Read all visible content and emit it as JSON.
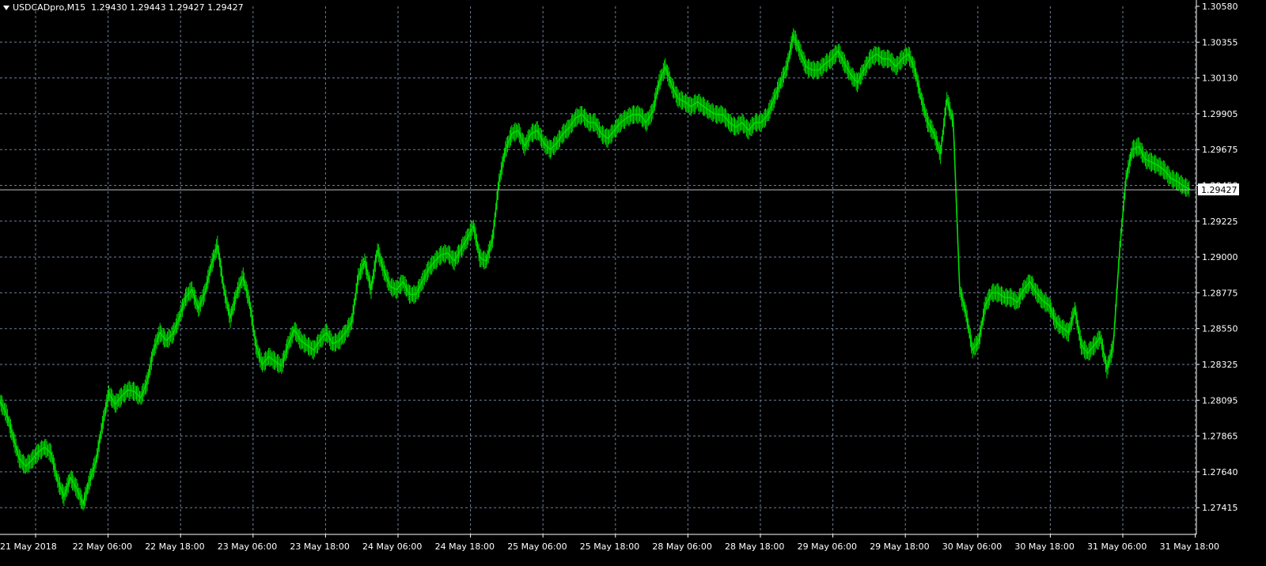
{
  "header": {
    "symbol_timeframe": "USDCADpro,M15",
    "ohlc": "1.29430 1.29443 1.29427 1.29427"
  },
  "colors": {
    "background": "#000000",
    "grid": "#6e7f98",
    "candle": "#00dd00",
    "axis_text": "#ffffff",
    "price_line": "#c0c0c0"
  },
  "chart_data": {
    "type": "line",
    "title": "",
    "xlabel": "",
    "ylabel": "",
    "grid": true,
    "ylim": [
      1.27302,
      1.3058
    ],
    "y_ticks": [
      "1.30580",
      "1.30355",
      "1.30130",
      "1.29905",
      "1.29675",
      "1.29450",
      "1.29225",
      "1.29000",
      "1.28775",
      "1.28550",
      "1.28325",
      "1.28095",
      "1.27865",
      "1.27640",
      "1.27415"
    ],
    "x_ticks": [
      "21 May 2018",
      "22 May 06:00",
      "22 May 18:00",
      "23 May 06:00",
      "23 May 18:00",
      "24 May 06:00",
      "24 May 18:00",
      "25 May 06:00",
      "25 May 18:00",
      "28 May 06:00",
      "28 May 18:00",
      "29 May 06:00",
      "29 May 18:00",
      "30 May 06:00",
      "30 May 18:00",
      "31 May 06:00",
      "31 May 18:00"
    ],
    "current_price": "1.29427",
    "series": [
      {
        "x": [
          "21 May 2018",
          "22 May 06:00",
          "22 May 18:00",
          "23 May 06:00",
          "23 May 18:00",
          "24 May 06:00",
          "24 May 18:00",
          "25 May 06:00",
          "25 May 18:00",
          "28 May 06:00",
          "28 May 18:00",
          "29 May 06:00",
          "29 May 18:00",
          "30 May 06:00",
          "30 May 18:00",
          "31 May 06:00",
          "31 May 18:00"
        ],
        "points": [
          [
            0,
            1.281
          ],
          [
            1,
            1.2802
          ],
          [
            2,
            1.2788
          ],
          [
            3,
            1.2774
          ],
          [
            4,
            1.2769
          ],
          [
            5,
            1.2773
          ],
          [
            6,
            1.2778
          ],
          [
            7,
            1.2781
          ],
          [
            8,
            1.2777
          ],
          [
            9,
            1.276
          ],
          [
            10,
            1.275
          ],
          [
            11,
            1.2762
          ],
          [
            12,
            1.2755
          ],
          [
            13,
            1.2745
          ],
          [
            14,
            1.276
          ],
          [
            15,
            1.2772
          ],
          [
            16,
            1.2795
          ],
          [
            17,
            1.2815
          ],
          [
            18,
            1.2808
          ],
          [
            19,
            1.2813
          ],
          [
            20,
            1.2817
          ],
          [
            21,
            1.2816
          ],
          [
            22,
            1.2812
          ],
          [
            23,
            1.2822
          ],
          [
            24,
            1.2842
          ],
          [
            25,
            1.2853
          ],
          [
            26,
            1.2848
          ],
          [
            27,
            1.2852
          ],
          [
            28,
            1.2862
          ],
          [
            29,
            1.2875
          ],
          [
            30,
            1.288
          ],
          [
            31,
            1.2868
          ],
          [
            32,
            1.2878
          ],
          [
            33,
            1.2895
          ],
          [
            34,
            1.2908
          ],
          [
            35,
            1.288
          ],
          [
            36,
            1.2862
          ],
          [
            37,
            1.2878
          ],
          [
            38,
            1.2888
          ],
          [
            39,
            1.2872
          ],
          [
            40,
            1.2845
          ],
          [
            41,
            1.2833
          ],
          [
            42,
            1.2838
          ],
          [
            43,
            1.2835
          ],
          [
            44,
            1.2832
          ],
          [
            45,
            1.2845
          ],
          [
            46,
            1.2855
          ],
          [
            47,
            1.2848
          ],
          [
            48,
            1.2845
          ],
          [
            49,
            1.2842
          ],
          [
            50,
            1.2848
          ],
          [
            51,
            1.2853
          ],
          [
            52,
            1.2846
          ],
          [
            53,
            1.2848
          ],
          [
            54,
            1.2853
          ],
          [
            55,
            1.286
          ],
          [
            56,
            1.2888
          ],
          [
            57,
            1.2898
          ],
          [
            58,
            1.288
          ],
          [
            59,
            1.2905
          ],
          [
            60,
            1.2892
          ],
          [
            61,
            1.2882
          ],
          [
            62,
            1.288
          ],
          [
            63,
            1.2885
          ],
          [
            64,
            1.2877
          ],
          [
            65,
            1.2877
          ],
          [
            66,
            1.2885
          ],
          [
            67,
            1.2893
          ],
          [
            68,
            1.2898
          ],
          [
            69,
            1.2902
          ],
          [
            70,
            1.2903
          ],
          [
            71,
            1.2898
          ],
          [
            72,
            1.2905
          ],
          [
            73,
            1.2912
          ],
          [
            74,
            1.292
          ],
          [
            75,
            1.29
          ],
          [
            76,
            1.2898
          ],
          [
            77,
            1.2912
          ],
          [
            78,
            1.2948
          ],
          [
            79,
            1.2968
          ],
          [
            80,
            1.2978
          ],
          [
            81,
            1.298
          ],
          [
            82,
            1.297
          ],
          [
            83,
            1.2978
          ],
          [
            84,
            1.298
          ],
          [
            85,
            1.2972
          ],
          [
            86,
            1.2968
          ],
          [
            87,
            1.2972
          ],
          [
            88,
            1.2978
          ],
          [
            89,
            1.2982
          ],
          [
            90,
            1.2988
          ],
          [
            91,
            1.299
          ],
          [
            92,
            1.2985
          ],
          [
            93,
            1.2985
          ],
          [
            94,
            1.2978
          ],
          [
            95,
            1.2975
          ],
          [
            96,
            1.298
          ],
          [
            97,
            1.2985
          ],
          [
            98,
            1.2988
          ],
          [
            99,
            1.299
          ],
          [
            100,
            1.299
          ],
          [
            101,
            1.2985
          ],
          [
            102,
            1.2992
          ],
          [
            103,
            1.301
          ],
          [
            104,
            1.302
          ],
          [
            105,
            1.3008
          ],
          [
            106,
            1.3
          ],
          [
            107,
            1.2998
          ],
          [
            108,
            1.2995
          ],
          [
            109,
            1.2998
          ],
          [
            110,
            1.2995
          ],
          [
            111,
            1.2992
          ],
          [
            112,
            1.299
          ],
          [
            113,
            1.299
          ],
          [
            114,
            1.2985
          ],
          [
            115,
            1.2982
          ],
          [
            116,
            1.2985
          ],
          [
            117,
            1.298
          ],
          [
            118,
            1.2985
          ],
          [
            119,
            1.2985
          ],
          [
            120,
            1.299
          ],
          [
            121,
            1.3
          ],
          [
            122,
            1.301
          ],
          [
            123,
            1.302
          ],
          [
            124,
            1.304
          ],
          [
            125,
            1.303
          ],
          [
            126,
            1.302
          ],
          [
            127,
            1.3018
          ],
          [
            128,
            1.3018
          ],
          [
            129,
            1.3022
          ],
          [
            130,
            1.3025
          ],
          [
            131,
            1.303
          ],
          [
            132,
            1.3022
          ],
          [
            133,
            1.3015
          ],
          [
            134,
            1.301
          ],
          [
            135,
            1.3018
          ],
          [
            136,
            1.3025
          ],
          [
            137,
            1.3028
          ],
          [
            138,
            1.3025
          ],
          [
            139,
            1.3025
          ],
          [
            140,
            1.302
          ],
          [
            141,
            1.3025
          ],
          [
            142,
            1.3028
          ],
          [
            143,
            1.3018
          ],
          [
            144,
            1.3
          ],
          [
            145,
            1.2985
          ],
          [
            146,
            1.2978
          ],
          [
            147,
            1.2965
          ],
          [
            148,
            1.3
          ],
          [
            149,
            1.2985
          ],
          [
            150,
            1.288
          ],
          [
            151,
            1.2865
          ],
          [
            152,
            1.2842
          ],
          [
            153,
            1.2848
          ],
          [
            154,
            1.287
          ],
          [
            155,
            1.2878
          ],
          [
            156,
            1.2878
          ],
          [
            157,
            1.2875
          ],
          [
            158,
            1.2875
          ],
          [
            159,
            1.2872
          ],
          [
            160,
            1.288
          ],
          [
            161,
            1.2885
          ],
          [
            162,
            1.2878
          ],
          [
            163,
            1.2873
          ],
          [
            164,
            1.287
          ],
          [
            165,
            1.286
          ],
          [
            166,
            1.2856
          ],
          [
            167,
            1.2853
          ],
          [
            168,
            1.2868
          ],
          [
            169,
            1.2845
          ],
          [
            170,
            1.284
          ],
          [
            171,
            1.2845
          ],
          [
            172,
            1.285
          ],
          [
            173,
            1.283
          ],
          [
            174,
            1.2845
          ],
          [
            175,
            1.2905
          ],
          [
            176,
            1.295
          ],
          [
            177,
            1.2968
          ],
          [
            178,
            1.297
          ],
          [
            179,
            1.2962
          ],
          [
            180,
            1.296
          ],
          [
            181,
            1.2958
          ],
          [
            182,
            1.2955
          ],
          [
            183,
            1.295
          ],
          [
            184,
            1.2948
          ],
          [
            185,
            1.2945
          ],
          [
            186,
            1.2943
          ]
        ]
      }
    ]
  }
}
